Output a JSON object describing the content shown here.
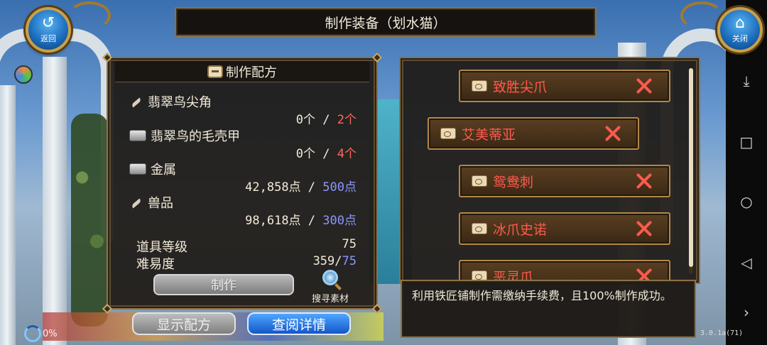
{
  "window": {
    "title": "制作装备（划水猫）"
  },
  "corner_buttons": {
    "back_label": "返回",
    "close_label": "关闭"
  },
  "recipe": {
    "header": "制作配方",
    "materials": [
      {
        "name": "翡翠鸟尖角",
        "have": "0个",
        "sep": " / ",
        "need": "2个",
        "icon": "feather-icon"
      },
      {
        "name": "翡翠鸟的毛壳甲",
        "have": "0个",
        "sep": " / ",
        "need": "4个",
        "icon": "shell-icon"
      },
      {
        "name": "金属",
        "have": "42,858点",
        "sep": " / ",
        "need": "500点",
        "icon": "metal-icon"
      },
      {
        "name": "兽品",
        "have": "98,618点",
        "sep": " / ",
        "need": "300点",
        "icon": "feather-icon"
      }
    ],
    "item_level_label": "道具等级",
    "item_level_value": "75",
    "difficulty_label": "难易度",
    "difficulty_current": "359/",
    "difficulty_target": "75",
    "craft_label": "制作",
    "search_label": "搜寻素材"
  },
  "equipment_list": [
    {
      "name": "致胜尖爪"
    },
    {
      "name": "艾美蒂亚"
    },
    {
      "name": "鸳鸯刺"
    },
    {
      "name": "冰爪史诺"
    },
    {
      "name": "恶灵爪"
    }
  ],
  "info_text": "利用铁匠铺制作需缴纳手续费，且100%制作成功。",
  "bottom": {
    "show_recipe": "显示配方",
    "view_detail": "查阅详情"
  },
  "status": {
    "progress": "0%",
    "version": "3.0.1a(71)"
  },
  "colors": {
    "missing": "#ff6a5a",
    "enough": "#8c96ff",
    "item_text": "#ff5a4e",
    "panel_border": "#8b7248"
  }
}
